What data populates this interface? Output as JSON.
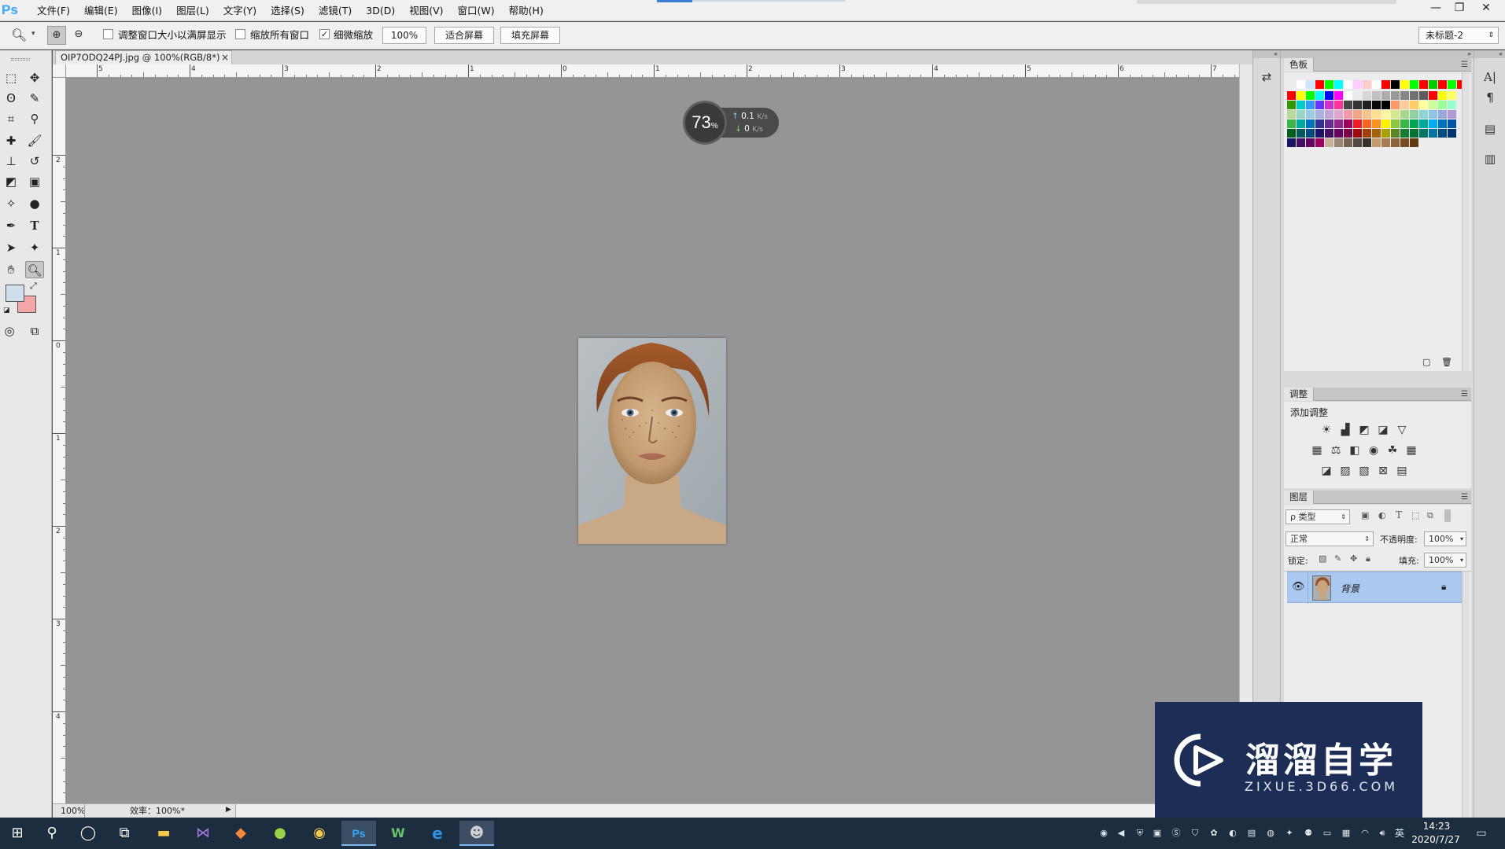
{
  "app": {
    "logo": "Ps"
  },
  "menu": [
    "文件(F)",
    "编辑(E)",
    "图像(I)",
    "图层(L)",
    "文字(Y)",
    "选择(S)",
    "滤镜(T)",
    "3D(D)",
    "视图(V)",
    "窗口(W)",
    "帮助(H)"
  ],
  "window_controls": {
    "minimize": "—",
    "restore": "❐",
    "close": "✕"
  },
  "options": {
    "resize_windows_label": "调整窗口大小以满屏显示",
    "resize_windows_checked": false,
    "zoom_all_label": "缩放所有窗口",
    "zoom_all_checked": false,
    "scrubby_zoom_label": "细微缩放",
    "scrubby_zoom_checked": true,
    "zoom_value": "100%",
    "fit_screen": "适合屏幕",
    "fill_screen": "填充屏幕",
    "workspace": "未标题-2"
  },
  "document": {
    "tab_title": "OIP7ODQ24PJ.jpg @ 100%(RGB/8*)",
    "close": "×",
    "ruler_top_labels": [
      "5",
      "4",
      "3",
      "2",
      "1",
      "0",
      "1",
      "2",
      "3",
      "4",
      "5",
      "6",
      "7"
    ],
    "ruler_left_labels": [
      "2",
      "1",
      "0",
      "1",
      "2",
      "3",
      "4"
    ]
  },
  "status": {
    "zoom": "100%",
    "efficiency": "效率：100%*"
  },
  "speed_widget": {
    "percent": "73",
    "percent_sign": "%",
    "up": "0.1",
    "down": "0",
    "unit": "K/s"
  },
  "panels": {
    "swatches": {
      "title": "色板"
    },
    "adjustments": {
      "title": "调整",
      "subtitle": "添加调整"
    },
    "layers": {
      "title": "图层",
      "filter_kind": "ρ 类型",
      "blend_mode": "正常",
      "opacity_label": "不透明度:",
      "opacity_value": "100%",
      "lock_label": "锁定:",
      "fill_label": "填充:",
      "fill_value": "100%",
      "layer_name": "背景"
    }
  },
  "watermark": {
    "title": "溜溜自学",
    "subtitle": "ZIXUE.3D66.COM"
  },
  "taskbar": {
    "time": "14:23",
    "date": "2020/7/27",
    "ime": "英"
  },
  "colors": {
    "foreground": "#cfe0ec",
    "background": "#f4a6a6",
    "canvas_gray": "#959595",
    "layer_selected": "#a9c9f1",
    "watermark_bg": "#1d2e56",
    "taskbar_bg": "#1c2d3f"
  }
}
